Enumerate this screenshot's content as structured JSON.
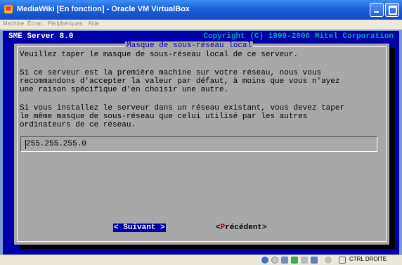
{
  "window": {
    "title": "MediaWiki [En fonction] - Oracle VM VirtualBox"
  },
  "menu": {
    "items": [
      "Machine",
      "Écran",
      "Périphériques",
      "Aide"
    ]
  },
  "console": {
    "header_left": "SME Server 8.0",
    "header_right": "Copyright (C) 1999-2006 Mitel Corporation",
    "dialog": {
      "title": "Masque de sous-réseau local",
      "paragraph1": "Veuillez taper le masque de sous-réseau local de ce serveur.",
      "paragraph2": "Si ce serveur est la première machine sur votre réseau, nous vous\nrecommandons d'accepter la valeur par défaut, à moins que vous n'ayez\nune raison spécifique d'en choisir une autre.",
      "paragraph3": "Si vous installez le serveur dans un réseau existant, vous devez taper\nle même masque de sous-réseau que celui utilisé par les autres\nordinateurs de ce réseau.",
      "input_value": "255.255.255.0",
      "next_button": "< Suivant >",
      "prev_button_open": "<",
      "prev_button_hot": "P",
      "prev_button_rest": "récédent>"
    }
  },
  "statusbar": {
    "host_key": "CTRL DROITE",
    "icons": [
      "hard-disk-icon",
      "optical-disk-icon",
      "usb-icon",
      "network-icon",
      "shared-folders-icon",
      "display-icon",
      "mouse-integration-icon",
      "host-key-icon"
    ]
  },
  "colors": {
    "console_bg": "#0000a8",
    "dialog_bg": "#a8a8a8",
    "title_fg": "#0000a8",
    "header_right_fg": "#00a8a8",
    "hotkey_fg": "#a80000",
    "xp_titlebar": "#1b5fd6"
  }
}
